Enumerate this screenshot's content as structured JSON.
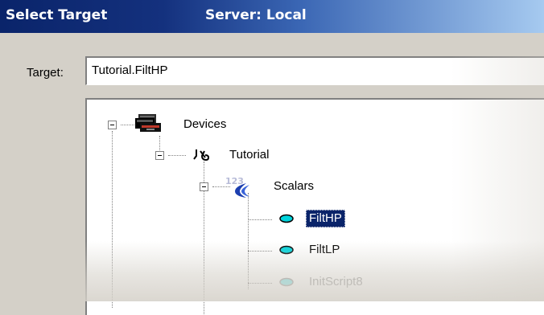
{
  "window": {
    "title": "Select Target",
    "server": "Server: Local"
  },
  "target": {
    "label": "Target:",
    "value": "Tutorial.FiltHP"
  },
  "tree": {
    "devices": {
      "label": "Devices",
      "icon": "devices-icon"
    },
    "tutorial": {
      "label": "Tutorial",
      "icon": "device-connector-icon"
    },
    "scalars": {
      "label": "Scalars",
      "icon": "scalars-folder-icon"
    },
    "items": [
      {
        "label": "FiltHP",
        "icon": "scalar-item-icon",
        "selected": true
      },
      {
        "label": "FiltLP",
        "icon": "scalar-item-icon",
        "selected": false
      },
      {
        "label": "InitScript8",
        "icon": "scalar-item-icon",
        "selected": false
      }
    ]
  },
  "colors": {
    "title_gradient_start": "#0a246a",
    "title_gradient_end": "#a6caf0",
    "selection": "#0a246a",
    "item_icon": "#00c8d0"
  }
}
